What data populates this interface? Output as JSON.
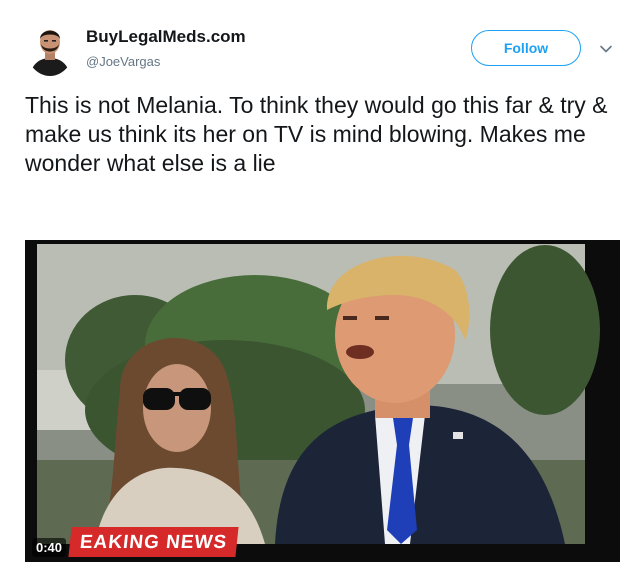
{
  "tweet": {
    "display_name": "BuyLegalMeds.com",
    "handle": "@JoeVargas",
    "follow_label": "Follow",
    "text": "This is not Melania. To think they would go this far & try & make us think its her on TV is mind blowing. Makes me wonder what else is a lie",
    "menu_icon": "chevron-down-icon",
    "avatar_icon": "avatar"
  },
  "video": {
    "timestamp": "0:40",
    "lower_third": "EAKING NEWS"
  },
  "colors": {
    "accent": "#1da1f2",
    "secondary_text": "#657786",
    "primary_text": "#14171a",
    "news_red": "#d62a2a"
  }
}
